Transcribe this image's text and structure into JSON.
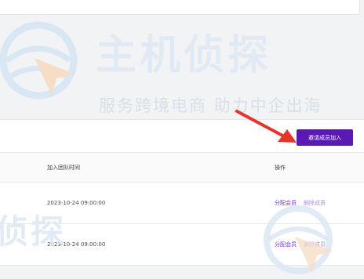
{
  "toolbar": {
    "invite_label": "邀请成员加入"
  },
  "table": {
    "columns": {
      "join_time": "加入团队时间",
      "actions": "操作"
    },
    "rows": [
      {
        "join_time": "2023-10-24 09:00:00",
        "assign": "分配会员",
        "remove": "删除成员"
      },
      {
        "join_time": "2023-10-24 09:00:00",
        "assign": "分配会员",
        "remove": "删除成员"
      }
    ]
  },
  "watermark": {
    "title": "主机侦探",
    "subtitle": "服务跨境电商 助力中企出海",
    "title_partial": "侦探"
  },
  "colors": {
    "accent": "#5a19b2",
    "link": "#7a2fd6",
    "annotation_arrow": "#e8332a"
  }
}
